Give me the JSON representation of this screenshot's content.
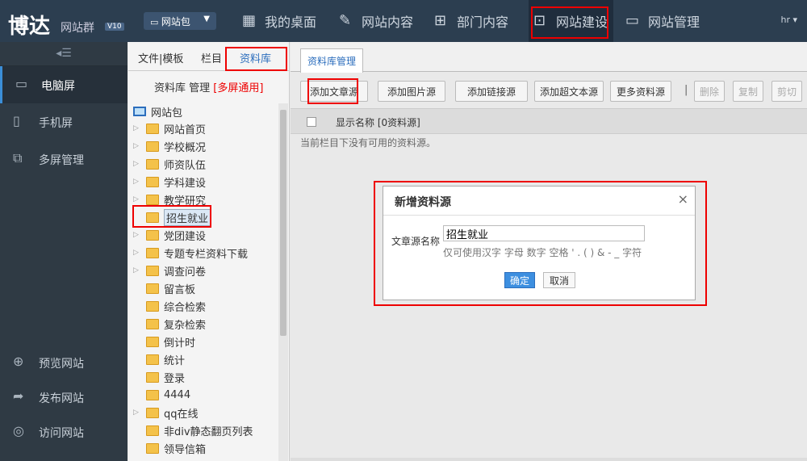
{
  "header": {
    "logo_main": "博达",
    "logo_sub": "网站群",
    "logo_ver": "V10",
    "site_pkg": "网站包",
    "nav": [
      {
        "label": "我的桌面",
        "icon": "grid-icon"
      },
      {
        "label": "网站内容",
        "icon": "edit-icon"
      },
      {
        "label": "部门内容",
        "icon": "org-icon"
      },
      {
        "label": "网站建设",
        "icon": "build-icon"
      },
      {
        "label": "网站管理",
        "icon": "monitor-settings-icon"
      }
    ],
    "user": "hr"
  },
  "sidebar": {
    "items": [
      {
        "label": "电脑屏",
        "icon": "monitor-icon"
      },
      {
        "label": "手机屏",
        "icon": "phone-icon"
      },
      {
        "label": "多屏管理",
        "icon": "multi-screen-icon"
      }
    ],
    "bottom": [
      {
        "label": "预览网站",
        "icon": "preview-icon"
      },
      {
        "label": "发布网站",
        "icon": "publish-icon"
      },
      {
        "label": "访问网站",
        "icon": "globe-icon"
      }
    ]
  },
  "col1": {
    "tabs": [
      "文件|模板",
      "栏目",
      "资料库"
    ],
    "title": "资料库 管理",
    "title_red": "[多屏通用]",
    "root": "网站包",
    "nodes": [
      {
        "label": "网站首页",
        "arrow": true
      },
      {
        "label": "学校概况",
        "arrow": true
      },
      {
        "label": "师资队伍",
        "arrow": true
      },
      {
        "label": "学科建设",
        "arrow": true
      },
      {
        "label": "教学研究",
        "arrow": true
      },
      {
        "label": "招生就业",
        "arrow": false
      },
      {
        "label": "党团建设",
        "arrow": true
      },
      {
        "label": "专题专栏资料下载",
        "arrow": true
      },
      {
        "label": "调查问卷",
        "arrow": true
      },
      {
        "label": "留言板",
        "arrow": false
      },
      {
        "label": "综合检索",
        "arrow": false
      },
      {
        "label": "复杂检索",
        "arrow": false
      },
      {
        "label": "倒计时",
        "arrow": false
      },
      {
        "label": "统计",
        "arrow": false
      },
      {
        "label": "登录",
        "arrow": false
      },
      {
        "label": "4444",
        "arrow": false
      },
      {
        "label": "qq在线",
        "arrow": true
      },
      {
        "label": "非div静态翻页列表",
        "arrow": false
      },
      {
        "label": "领导信箱",
        "arrow": false
      }
    ]
  },
  "col2": {
    "tab": "资料库管理",
    "buttons": [
      "添加文章源",
      "添加图片源",
      "添加链接源",
      "添加超文本源",
      "更多资料源"
    ],
    "sep": "|",
    "dis_buttons": [
      "删除",
      "复制",
      "剪切"
    ],
    "header": "显示名称 [0资料源]",
    "empty": "当前栏目下没有可用的资料源。"
  },
  "modal": {
    "title": "新增资料源",
    "close": "×",
    "label": "文章源名称",
    "value": "招生就业",
    "hint": "仅可使用汉字 字母 数字 空格 ' . ( ) & - _ 字符",
    "ok": "确定",
    "cancel": "取消"
  }
}
